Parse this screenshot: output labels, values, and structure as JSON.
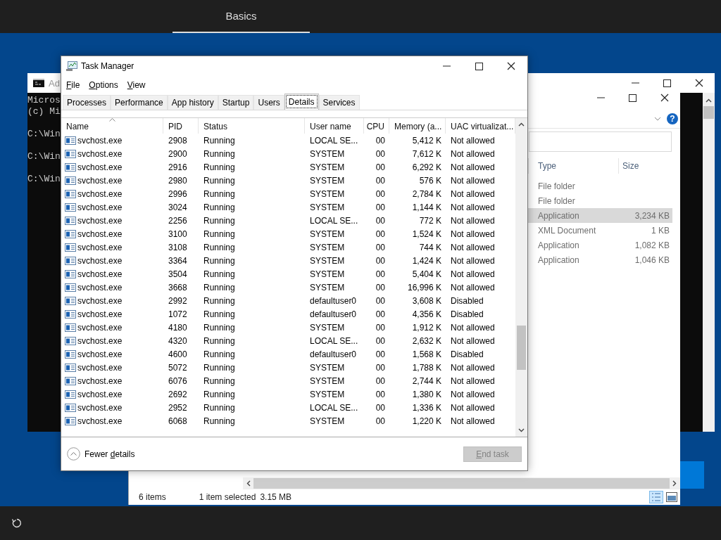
{
  "top_bar": {
    "tabs": [
      {
        "label": "Basics",
        "selected": true
      }
    ]
  },
  "cmd": {
    "title": "Ad",
    "blocks": [
      [
        "Micros",
        "(c) Mi"
      ],
      [
        "C:\\Win"
      ],
      [
        "C:\\Win"
      ],
      [
        "C:\\Win"
      ]
    ]
  },
  "explorer": {
    "help_label": "?",
    "columns": [
      "Type",
      "Size"
    ],
    "rows": [
      {
        "type": "File folder",
        "selected": false
      },
      {
        "type": "File folder",
        "selected": false
      },
      {
        "type": "Application",
        "size": "3,234 KB",
        "selected": true
      },
      {
        "type": "XML Document",
        "size": "1 KB",
        "selected": false
      },
      {
        "type": "Application",
        "size": "1,082 KB",
        "selected": false
      },
      {
        "type": "Application",
        "size": "1,046 KB",
        "selected": false
      }
    ],
    "status": {
      "items": "6 items",
      "selected": "1 item selected",
      "size": "3.15 MB"
    }
  },
  "task_manager": {
    "title": "Task Manager",
    "menu": [
      {
        "key": "F",
        "rest": "ile"
      },
      {
        "key": "O",
        "rest": "ptions"
      },
      {
        "key": "V",
        "rest": "iew"
      }
    ],
    "tabs": [
      {
        "label": "Processes",
        "selected": false
      },
      {
        "label": "Performance",
        "selected": false
      },
      {
        "label": "App history",
        "selected": false
      },
      {
        "label": "Startup",
        "selected": false
      },
      {
        "label": "Users",
        "selected": false
      },
      {
        "label": "Details",
        "selected": true
      },
      {
        "label": "Services",
        "selected": false
      }
    ],
    "columns": [
      {
        "label": "Name",
        "sorted": true
      },
      {
        "label": "PID",
        "sorted": false
      },
      {
        "label": "Status",
        "sorted": false
      },
      {
        "label": "User name",
        "sorted": false
      },
      {
        "label": "CPU",
        "sorted": false
      },
      {
        "label": "Memory (a...",
        "sorted": false
      },
      {
        "label": "UAC virtualizat...",
        "sorted": false
      }
    ],
    "rows": [
      {
        "name": "svchost.exe",
        "pid": "2908",
        "status": "Running",
        "user": "LOCAL SE...",
        "cpu": "00",
        "memory": "5,412 K",
        "uac": "Not allowed"
      },
      {
        "name": "svchost.exe",
        "pid": "2900",
        "status": "Running",
        "user": "SYSTEM",
        "cpu": "00",
        "memory": "7,612 K",
        "uac": "Not allowed"
      },
      {
        "name": "svchost.exe",
        "pid": "2916",
        "status": "Running",
        "user": "SYSTEM",
        "cpu": "00",
        "memory": "6,292 K",
        "uac": "Not allowed"
      },
      {
        "name": "svchost.exe",
        "pid": "2980",
        "status": "Running",
        "user": "SYSTEM",
        "cpu": "00",
        "memory": "576 K",
        "uac": "Not allowed"
      },
      {
        "name": "svchost.exe",
        "pid": "2996",
        "status": "Running",
        "user": "SYSTEM",
        "cpu": "00",
        "memory": "2,784 K",
        "uac": "Not allowed"
      },
      {
        "name": "svchost.exe",
        "pid": "3024",
        "status": "Running",
        "user": "SYSTEM",
        "cpu": "00",
        "memory": "1,144 K",
        "uac": "Not allowed"
      },
      {
        "name": "svchost.exe",
        "pid": "2256",
        "status": "Running",
        "user": "LOCAL SE...",
        "cpu": "00",
        "memory": "772 K",
        "uac": "Not allowed"
      },
      {
        "name": "svchost.exe",
        "pid": "3100",
        "status": "Running",
        "user": "SYSTEM",
        "cpu": "00",
        "memory": "1,524 K",
        "uac": "Not allowed"
      },
      {
        "name": "svchost.exe",
        "pid": "3108",
        "status": "Running",
        "user": "SYSTEM",
        "cpu": "00",
        "memory": "744 K",
        "uac": "Not allowed"
      },
      {
        "name": "svchost.exe",
        "pid": "3364",
        "status": "Running",
        "user": "SYSTEM",
        "cpu": "00",
        "memory": "1,424 K",
        "uac": "Not allowed"
      },
      {
        "name": "svchost.exe",
        "pid": "3504",
        "status": "Running",
        "user": "SYSTEM",
        "cpu": "00",
        "memory": "5,404 K",
        "uac": "Not allowed"
      },
      {
        "name": "svchost.exe",
        "pid": "3668",
        "status": "Running",
        "user": "SYSTEM",
        "cpu": "00",
        "memory": "16,996 K",
        "uac": "Not allowed"
      },
      {
        "name": "svchost.exe",
        "pid": "2992",
        "status": "Running",
        "user": "defaultuser0",
        "cpu": "00",
        "memory": "3,608 K",
        "uac": "Disabled"
      },
      {
        "name": "svchost.exe",
        "pid": "1072",
        "status": "Running",
        "user": "defaultuser0",
        "cpu": "00",
        "memory": "4,356 K",
        "uac": "Disabled"
      },
      {
        "name": "svchost.exe",
        "pid": "4180",
        "status": "Running",
        "user": "SYSTEM",
        "cpu": "00",
        "memory": "1,912 K",
        "uac": "Not allowed"
      },
      {
        "name": "svchost.exe",
        "pid": "4320",
        "status": "Running",
        "user": "LOCAL SE...",
        "cpu": "00",
        "memory": "2,632 K",
        "uac": "Not allowed"
      },
      {
        "name": "svchost.exe",
        "pid": "4600",
        "status": "Running",
        "user": "defaultuser0",
        "cpu": "00",
        "memory": "1,568 K",
        "uac": "Disabled"
      },
      {
        "name": "svchost.exe",
        "pid": "5072",
        "status": "Running",
        "user": "SYSTEM",
        "cpu": "00",
        "memory": "1,788 K",
        "uac": "Not allowed"
      },
      {
        "name": "svchost.exe",
        "pid": "6076",
        "status": "Running",
        "user": "SYSTEM",
        "cpu": "00",
        "memory": "2,744 K",
        "uac": "Not allowed"
      },
      {
        "name": "svchost.exe",
        "pid": "2692",
        "status": "Running",
        "user": "SYSTEM",
        "cpu": "00",
        "memory": "1,380 K",
        "uac": "Not allowed"
      },
      {
        "name": "svchost.exe",
        "pid": "2952",
        "status": "Running",
        "user": "LOCAL SE...",
        "cpu": "00",
        "memory": "1,336 K",
        "uac": "Not allowed"
      },
      {
        "name": "svchost.exe",
        "pid": "6068",
        "status": "Running",
        "user": "SYSTEM",
        "cpu": "00",
        "memory": "1,220 K",
        "uac": "Not allowed"
      }
    ],
    "footer": {
      "fewer": {
        "pre": "Fewer ",
        "key": "d",
        "rest": "etails"
      },
      "end_task": {
        "key": "E",
        "rest": "nd task",
        "disabled": true
      }
    }
  }
}
